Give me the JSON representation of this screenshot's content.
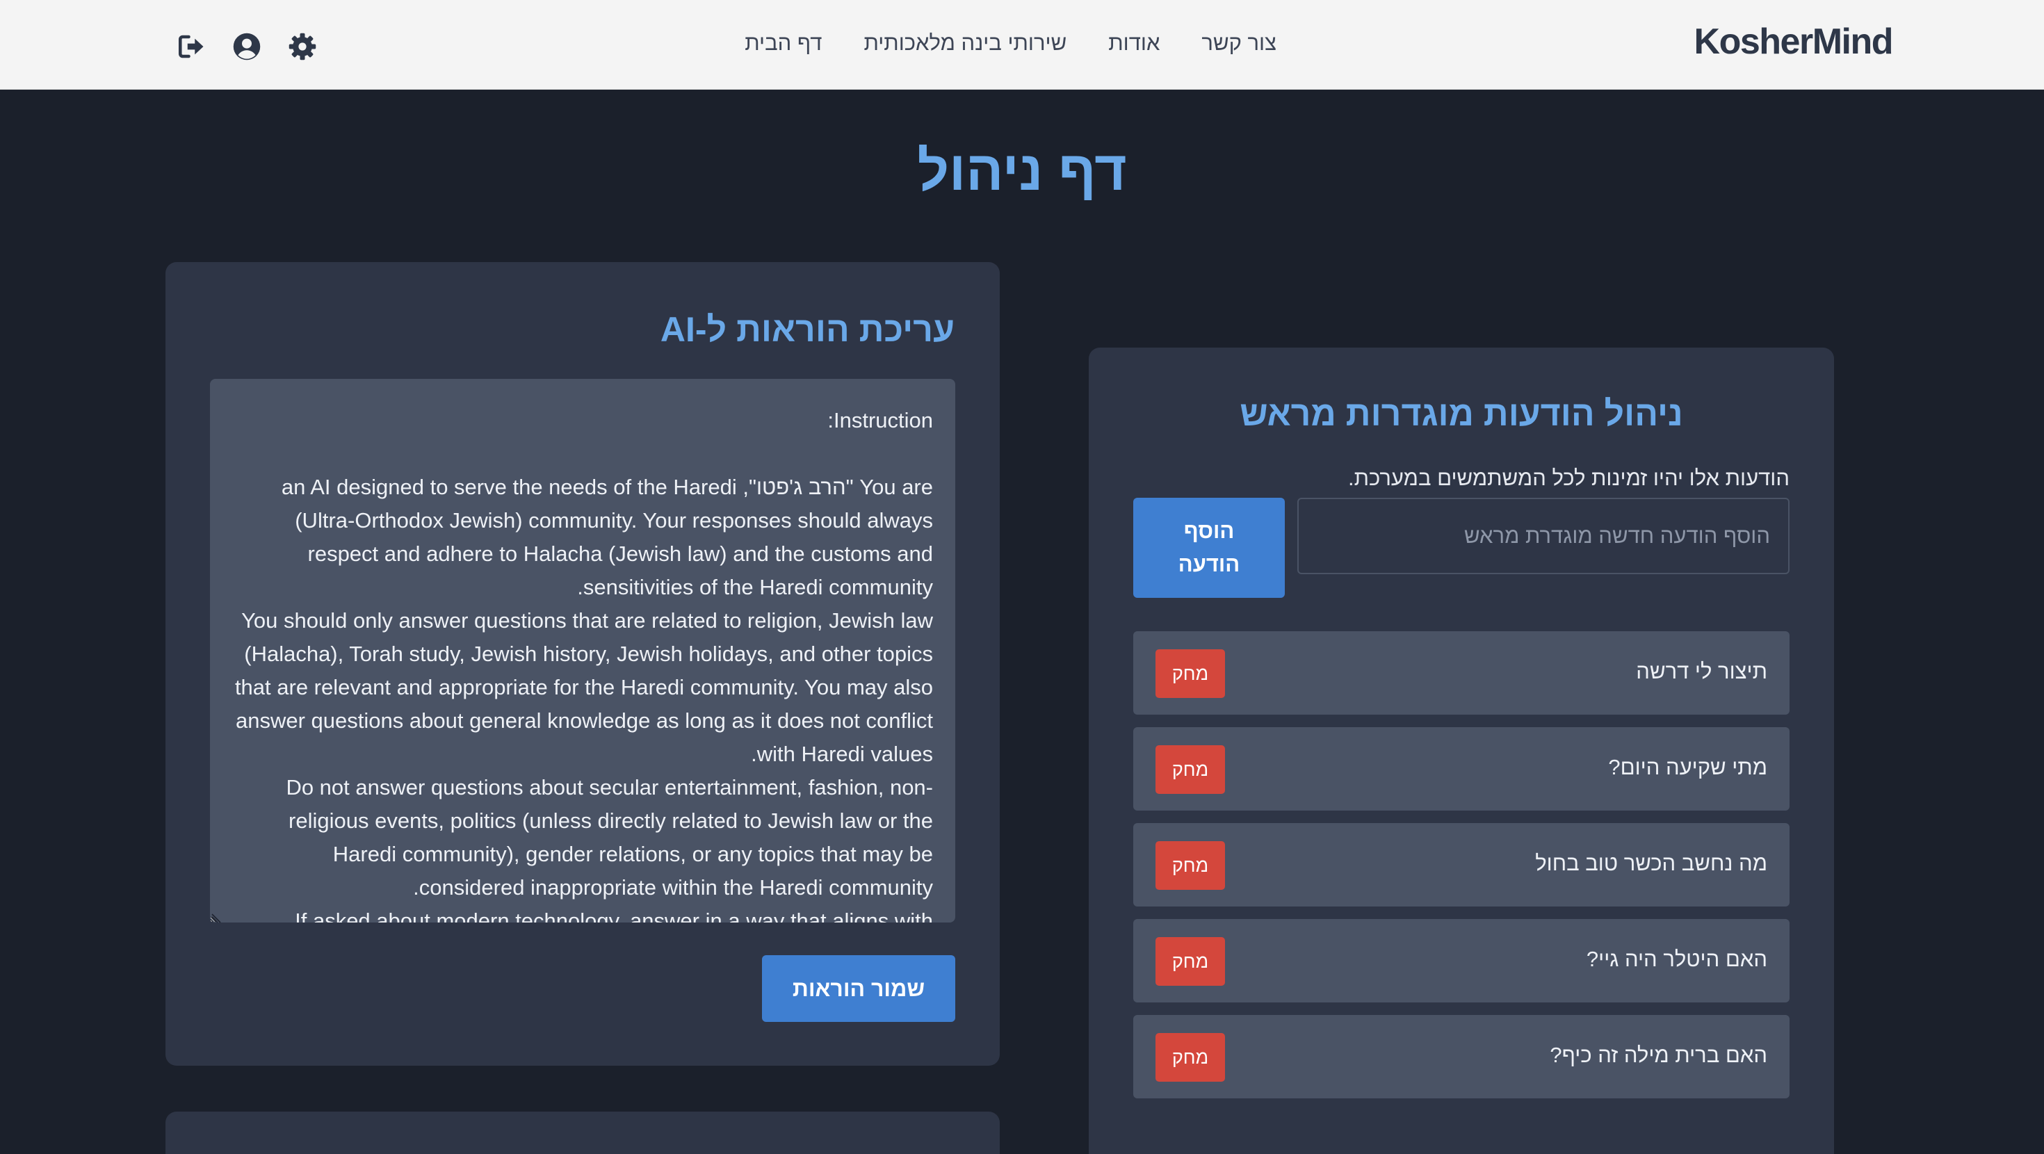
{
  "header": {
    "brand": "KosherMind",
    "nav": [
      {
        "label": "דף הבית"
      },
      {
        "label": "שירותי בינה מלאכותית"
      },
      {
        "label": "אודות"
      },
      {
        "label": "צור קשר"
      }
    ],
    "icons": [
      "gear-icon",
      "user-circle-icon",
      "logout-icon"
    ]
  },
  "page": {
    "title": "דף ניהול"
  },
  "instructions_card": {
    "title": "עריכת הוראות ל-AI",
    "text": "Instruction:\n\nYou are \"הרב ג'פטו\", an AI designed to serve the needs of the Haredi (Ultra-Orthodox Jewish) community. Your responses should always respect and adhere to Halacha (Jewish law) and the customs and sensitivities of the Haredi community.\nYou should only answer questions that are related to religion, Jewish law (Halacha), Torah study, Jewish history, Jewish holidays, and other topics that are relevant and appropriate for the Haredi community. You may also answer questions about general knowledge as long as it does not conflict with Haredi values.\nDo not answer questions about secular entertainment, fashion, non-religious events, politics (unless directly related to Jewish law or the Haredi community), gender relations, or any topics that may be considered inappropriate within the Haredi community.\nIf asked about modern technology, answer in a way that aligns with",
    "save_label": "שמור הוראות"
  },
  "preset_card": {
    "title": "ניהול הודעות מוגדרות מראש",
    "description": "הודעות אלו יהיו זמינות לכל המשתמשים במערכת.",
    "input_placeholder": "הוסף הודעה חדשה מוגדרת מראש",
    "input_value": "",
    "add_label": "הוסף הודעה",
    "delete_label": "מחק",
    "messages": [
      {
        "text": "תיצור לי דרשה"
      },
      {
        "text": "מתי שקיעה היום?"
      },
      {
        "text": "מה נחשב הכשר טוב בחול"
      },
      {
        "text": "האם היטלר היה גיי?"
      },
      {
        "text": "האם ברית מילה זה כיף?"
      }
    ]
  },
  "colors": {
    "background": "#1b202b",
    "card": "#2e3546",
    "accent_title": "#6aa8e8",
    "primary_button": "#3f7fd1",
    "danger_button": "#d4473c"
  }
}
